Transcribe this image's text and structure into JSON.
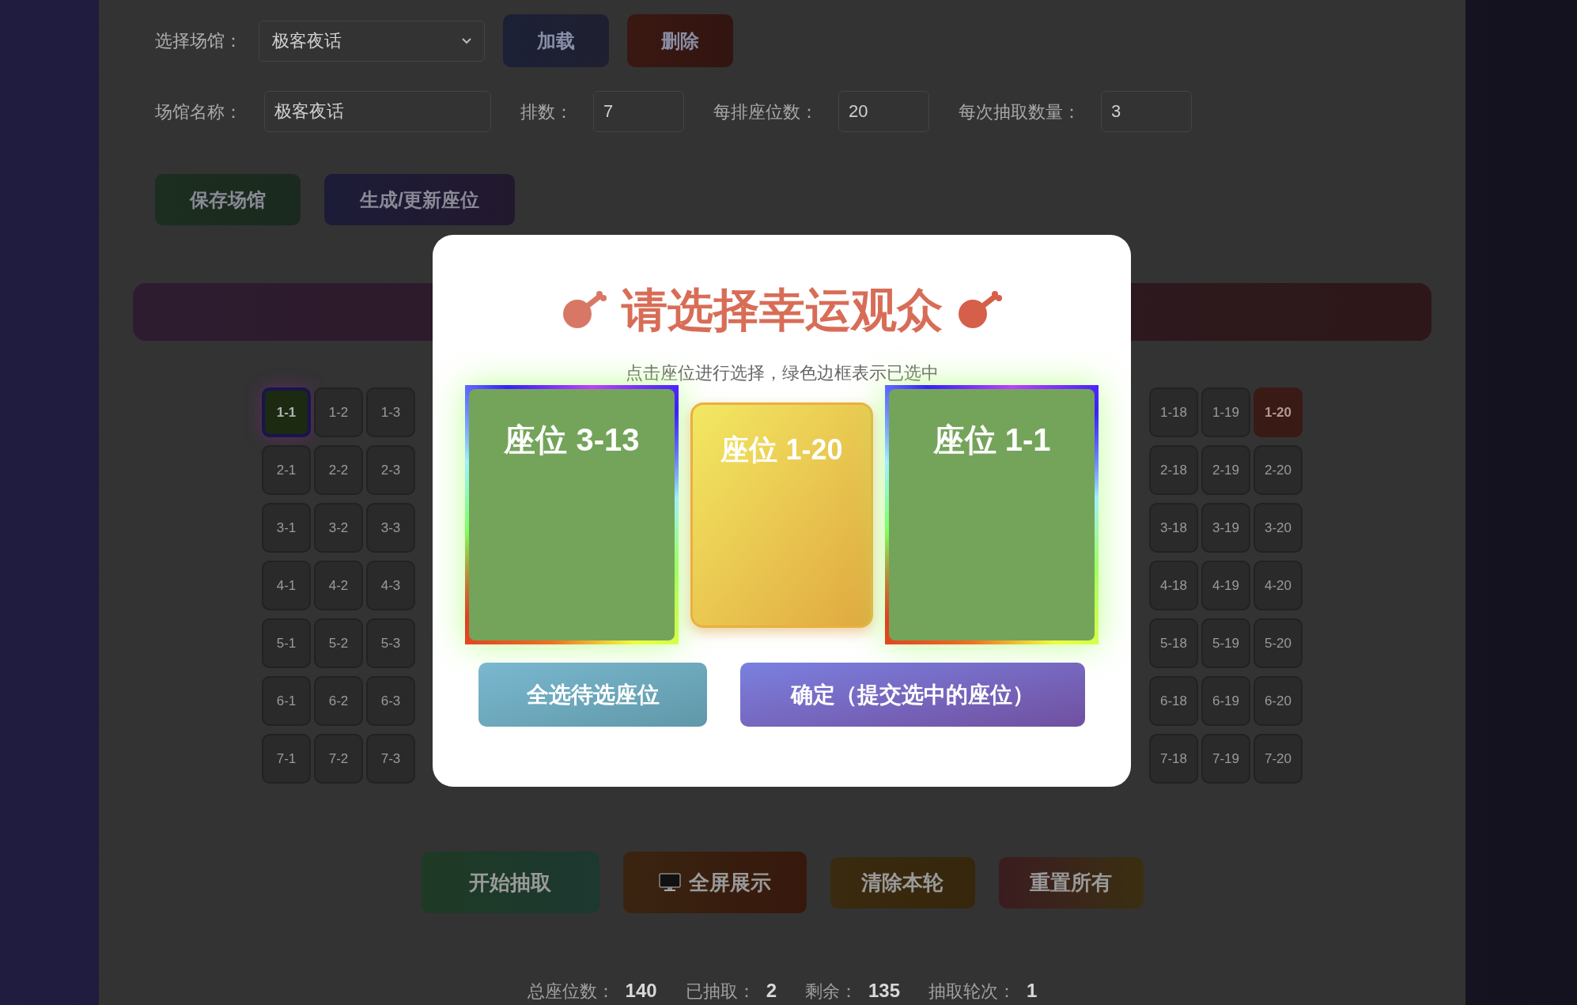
{
  "venue_bar": {
    "label": "选择场馆：",
    "select": {
      "value": "极客夜话"
    },
    "buttons": [
      {
        "label": "加载",
        "kind": "load"
      },
      {
        "label": "删除",
        "kind": "delete"
      }
    ]
  },
  "venue_form": {
    "fields": [
      {
        "label": "场馆名称：",
        "value": "极客夜话",
        "kind": "wide"
      },
      {
        "label": "排数：",
        "value": "7",
        "kind": "narrow"
      },
      {
        "label": "每排座位数：",
        "value": "20",
        "kind": "narrow"
      },
      {
        "label": "每次抽取数量：",
        "value": "3",
        "kind": "narrow"
      }
    ],
    "buttons": [
      {
        "label": "保存场馆",
        "kind": "save"
      },
      {
        "label": "生成/更新座位",
        "kind": "generate"
      }
    ]
  },
  "seat_rows": [
    {
      "left": [
        {
          "label": "1-1",
          "picked": true,
          "drawn": false
        },
        {
          "label": "1-2",
          "picked": false,
          "drawn": false
        },
        {
          "label": "1-3",
          "picked": false,
          "drawn": false
        }
      ],
      "right": [
        {
          "label": "1-18",
          "picked": false,
          "drawn": false
        },
        {
          "label": "1-19",
          "picked": false,
          "drawn": false
        },
        {
          "label": "1-20",
          "picked": false,
          "drawn": true
        }
      ]
    },
    {
      "left": [
        {
          "label": "2-1",
          "picked": false,
          "drawn": false
        },
        {
          "label": "2-2",
          "picked": false,
          "drawn": false
        },
        {
          "label": "2-3",
          "picked": false,
          "drawn": false
        }
      ],
      "right": [
        {
          "label": "2-18",
          "picked": false,
          "drawn": false
        },
        {
          "label": "2-19",
          "picked": false,
          "drawn": false
        },
        {
          "label": "2-20",
          "picked": false,
          "drawn": false
        }
      ]
    },
    {
      "left": [
        {
          "label": "3-1",
          "picked": false,
          "drawn": false
        },
        {
          "label": "3-2",
          "picked": false,
          "drawn": false
        },
        {
          "label": "3-3",
          "picked": false,
          "drawn": false
        }
      ],
      "right": [
        {
          "label": "3-18",
          "picked": false,
          "drawn": false
        },
        {
          "label": "3-19",
          "picked": false,
          "drawn": false
        },
        {
          "label": "3-20",
          "picked": false,
          "drawn": false
        }
      ]
    },
    {
      "left": [
        {
          "label": "4-1",
          "picked": false,
          "drawn": false
        },
        {
          "label": "4-2",
          "picked": false,
          "drawn": false
        },
        {
          "label": "4-3",
          "picked": false,
          "drawn": false
        }
      ],
      "right": [
        {
          "label": "4-18",
          "picked": false,
          "drawn": false
        },
        {
          "label": "4-19",
          "picked": false,
          "drawn": false
        },
        {
          "label": "4-20",
          "picked": false,
          "drawn": false
        }
      ]
    },
    {
      "left": [
        {
          "label": "5-1",
          "picked": false,
          "drawn": false
        },
        {
          "label": "5-2",
          "picked": false,
          "drawn": false
        },
        {
          "label": "5-3",
          "picked": false,
          "drawn": false
        }
      ],
      "right": [
        {
          "label": "5-18",
          "picked": false,
          "drawn": false
        },
        {
          "label": "5-19",
          "picked": false,
          "drawn": false
        },
        {
          "label": "5-20",
          "picked": false,
          "drawn": false
        }
      ]
    },
    {
      "left": [
        {
          "label": "6-1",
          "picked": false,
          "drawn": false
        },
        {
          "label": "6-2",
          "picked": false,
          "drawn": false
        },
        {
          "label": "6-3",
          "picked": false,
          "drawn": false
        }
      ],
      "right": [
        {
          "label": "6-18",
          "picked": false,
          "drawn": false
        },
        {
          "label": "6-19",
          "picked": false,
          "drawn": false
        },
        {
          "label": "6-20",
          "picked": false,
          "drawn": false
        }
      ]
    },
    {
      "left": [
        {
          "label": "7-1",
          "picked": false,
          "drawn": false
        },
        {
          "label": "7-2",
          "picked": false,
          "drawn": false
        },
        {
          "label": "7-3",
          "picked": false,
          "drawn": false
        }
      ],
      "right": [
        {
          "label": "7-18",
          "picked": false,
          "drawn": false
        },
        {
          "label": "7-19",
          "picked": false,
          "drawn": false
        },
        {
          "label": "7-20",
          "picked": false,
          "drawn": false
        }
      ]
    }
  ],
  "actions": [
    {
      "label": "开始抽取",
      "kind": "start"
    },
    {
      "label": "全屏展示",
      "kind": "fullscreen"
    },
    {
      "label": "清除本轮",
      "kind": "clear"
    },
    {
      "label": "重置所有",
      "kind": "reset"
    }
  ],
  "stats": [
    {
      "label": "总座位数：",
      "value": "140"
    },
    {
      "label": "已抽取：",
      "value": "2"
    },
    {
      "label": "剩余：",
      "value": "135"
    },
    {
      "label": "抽取轮次：",
      "value": "1"
    }
  ],
  "modal": {
    "title": "请选择幸运观众",
    "hint": "点击座位进行选择，绿色边框表示已选中",
    "cards": [
      {
        "label": "座位 3-13",
        "selected": true
      },
      {
        "label": "座位 1-20",
        "selected": false
      },
      {
        "label": "座位 1-1",
        "selected": true
      }
    ],
    "buttons": [
      {
        "label": "全选待选座位",
        "kind": "select_all"
      },
      {
        "label": "确定（提交选中的座位）",
        "kind": "confirm"
      }
    ]
  }
}
